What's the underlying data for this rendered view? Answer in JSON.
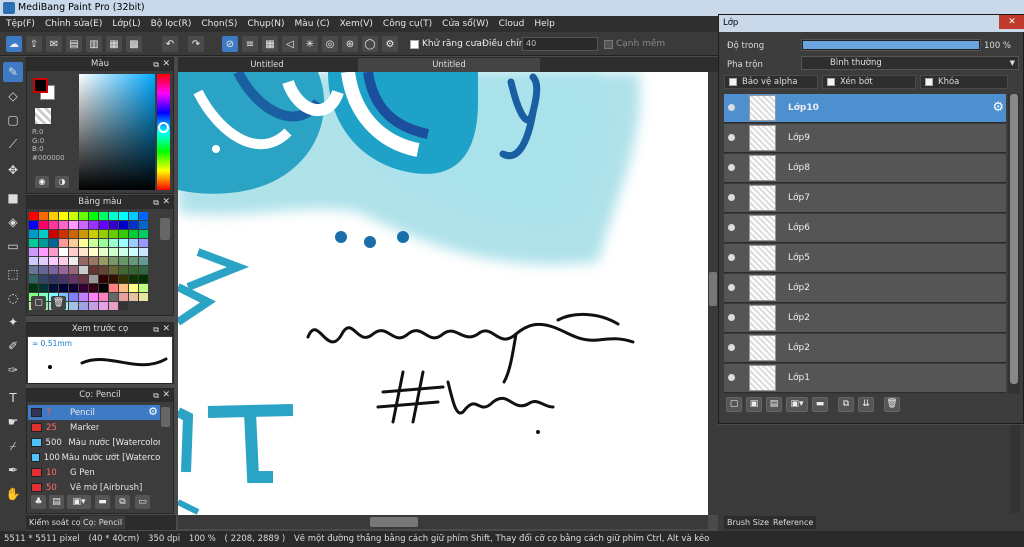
{
  "window": {
    "title": "MediBang Paint Pro (32bit)"
  },
  "menu": [
    "Tệp(F)",
    "Chỉnh sửa(E)",
    "Lớp(L)",
    "Bộ lọc(R)",
    "Chọn(S)",
    "Chụp(N)",
    "Màu (C)",
    "Xem(V)",
    "Công cụ(T)",
    "Cửa sổ(W)",
    "Cloud",
    "Help"
  ],
  "toolbar": {
    "antialias_label": "Khử răng cưa",
    "adjust_label": "Điều chỉnh",
    "adjust_value": "40",
    "edge_label": "Cạnh mềm"
  },
  "color_panel": {
    "title": "Màu",
    "r": "R:0",
    "g": "G:0",
    "b": "B:0",
    "hex": "#000000",
    "fg": "#000000",
    "bg": "#ffffff"
  },
  "palette": {
    "title": "Bảng màu",
    "placeholder": "---"
  },
  "preview": {
    "title": "Xem trước cọ",
    "size": "0.51mm"
  },
  "brush": {
    "title": "Cọ: Pencil",
    "items": [
      {
        "size": "7",
        "name": "Pencil",
        "color": "#333355",
        "selected": true
      },
      {
        "size": "25",
        "name": "Marker",
        "color": "#e03030",
        "selected": false
      },
      {
        "size": "500",
        "name": "Màu nước [Watercolor]",
        "color": "#4fc3f7",
        "selected": false
      },
      {
        "size": "100",
        "name": "Màu nước ướt [Watercolor Wet]",
        "color": "#4fc3f7",
        "selected": false
      },
      {
        "size": "10",
        "name": "G Pen",
        "color": "#e03030",
        "selected": false
      },
      {
        "size": "50",
        "name": "Vẽ mờ [Airbrush]",
        "color": "#e03030",
        "selected": false
      }
    ]
  },
  "left_tabs": [
    "Kiểm soát cọ",
    "Cọ: Pencil"
  ],
  "doc_tabs": [
    "Untitled",
    "Untitled"
  ],
  "canvas": {
    "signature_line1": "browncony1207",
    "signature_line2": "#LBR07"
  },
  "status": {
    "dims": "5511 * 5511 pixel",
    "size_cm": "(40 * 40cm)",
    "dpi": "350 dpi",
    "zoom": "100 %",
    "coords": "( 2208, 2889 )",
    "hint": "Vẽ một đường thẳng bằng cách giữ phím Shift, Thay đổi cỡ cọ bằng cách giữ phím Ctrl, Alt và kéo"
  },
  "layer_window": {
    "title": "Lớp",
    "opacity_label": "Độ trong",
    "opacity_value": "100 %",
    "opacity_fraction": 1.0,
    "blend_label": "Pha trộn",
    "blend_value": "Bình thường",
    "opt_alpha": "Bảo vệ alpha",
    "opt_clip": "Xén bớt",
    "opt_lock": "Khóa",
    "layers": [
      {
        "name": "Lớp10",
        "selected": true
      },
      {
        "name": "Lớp9",
        "selected": false
      },
      {
        "name": "Lớp8",
        "selected": false
      },
      {
        "name": "Lớp7",
        "selected": false
      },
      {
        "name": "Lớp6",
        "selected": false
      },
      {
        "name": "Lớp5",
        "selected": false
      },
      {
        "name": "Lớp2",
        "selected": false
      },
      {
        "name": "Lớp2",
        "selected": false
      },
      {
        "name": "Lớp2",
        "selected": false
      },
      {
        "name": "Lớp1",
        "selected": false
      }
    ]
  },
  "right_tabs": [
    "Brush Size",
    "Reference"
  ]
}
